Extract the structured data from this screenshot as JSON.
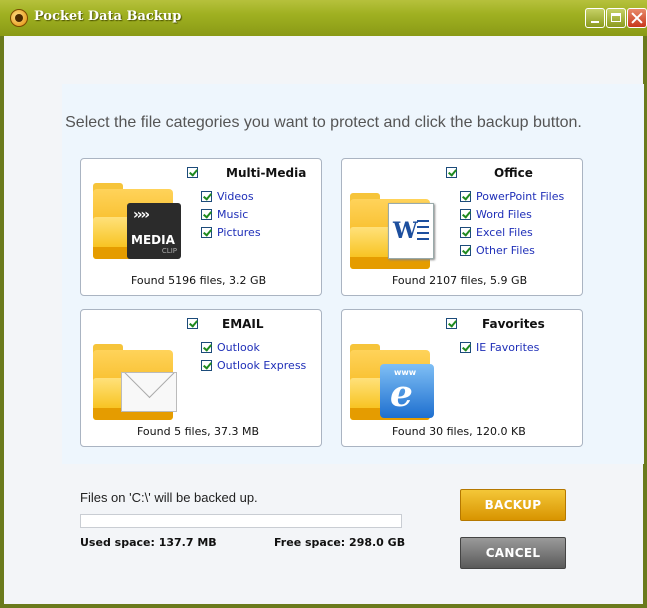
{
  "window": {
    "title": "Pocket Data Backup"
  },
  "instruction": "Select the file categories you want to protect and click the backup button.",
  "categories": {
    "multimedia": {
      "title": "Multi-Media",
      "checked": true,
      "icon": "media-clip-folder-icon",
      "icon_text": "MEDIA",
      "icon_subtext": "CLIP",
      "items": [
        {
          "label": "Videos",
          "checked": true
        },
        {
          "label": "Music",
          "checked": true
        },
        {
          "label": "Pictures",
          "checked": true
        }
      ],
      "found": "Found 5196 files, 3.2 GB"
    },
    "office": {
      "title": "Office",
      "checked": true,
      "icon": "word-document-folder-icon",
      "items": [
        {
          "label": "PowerPoint Files",
          "checked": true
        },
        {
          "label": "Word Files",
          "checked": true
        },
        {
          "label": "Excel Files",
          "checked": true
        },
        {
          "label": "Other Files",
          "checked": true
        }
      ],
      "found": "Found 2107 files, 5.9 GB"
    },
    "email": {
      "title": "EMAIL",
      "checked": true,
      "icon": "envelope-folder-icon",
      "items": [
        {
          "label": "Outlook",
          "checked": true
        },
        {
          "label": "Outlook Express",
          "checked": true
        }
      ],
      "found": "Found 5 files, 37.3 MB"
    },
    "favorites": {
      "title": "Favorites",
      "checked": true,
      "icon": "ie-folder-icon",
      "icon_text": "www",
      "items": [
        {
          "label": "IE Favorites",
          "checked": true
        }
      ],
      "found": "Found 30 files, 120.0 KB"
    }
  },
  "status": {
    "message": "Files on 'C:\\' will be backed up.",
    "progress_fraction": 0,
    "used_space": "Used space: 137.7 MB",
    "free_space": "Free space: 298.0 GB"
  },
  "buttons": {
    "backup": "BACKUP",
    "cancel": "CANCEL"
  },
  "colors": {
    "titlebar": "#9fb021",
    "backup_button": "#e6a90e",
    "cancel_button": "#7a7a7a",
    "link_text": "#1f2fb8"
  }
}
